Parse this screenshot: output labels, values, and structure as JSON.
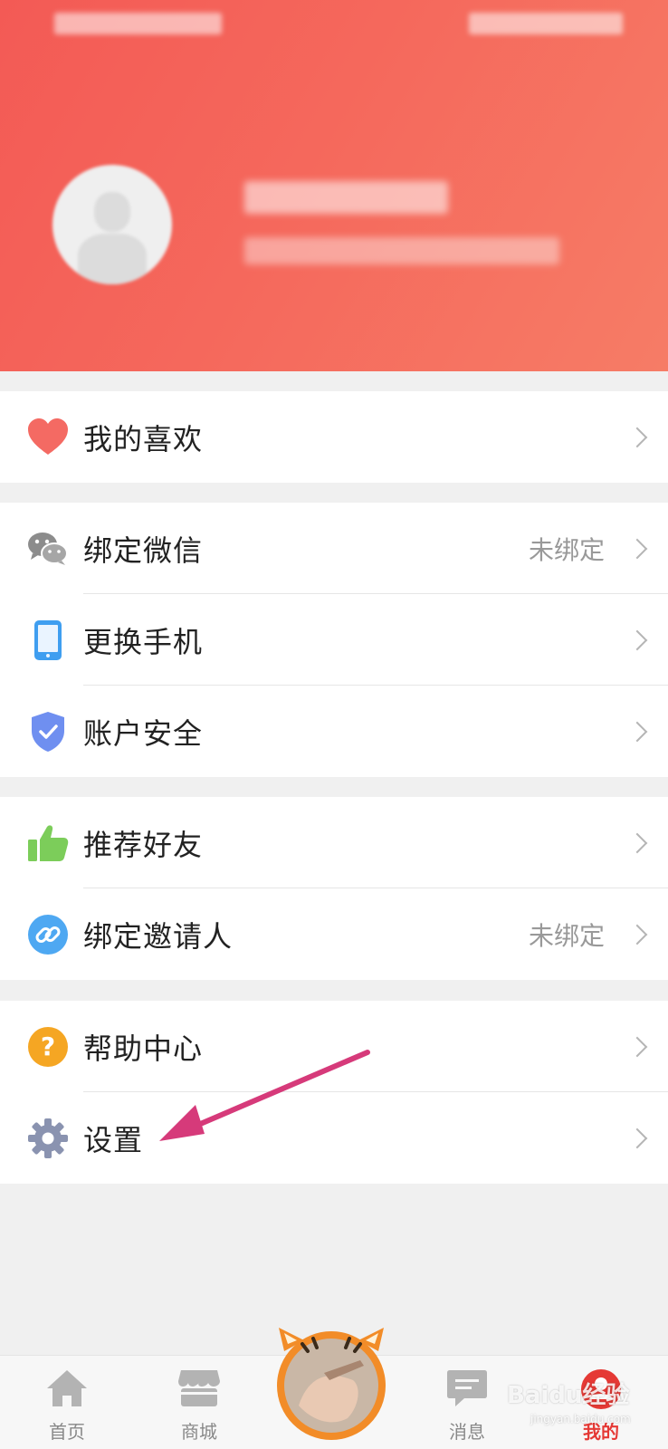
{
  "profile": {
    "status_bar": "",
    "username": "",
    "user_info": ""
  },
  "menu": {
    "favorites": {
      "label": "我的喜欢"
    },
    "bind_wechat": {
      "label": "绑定微信",
      "value": "未绑定"
    },
    "change_phone": {
      "label": "更换手机"
    },
    "account_security": {
      "label": "账户安全"
    },
    "recommend_friends": {
      "label": "推荐好友"
    },
    "bind_inviter": {
      "label": "绑定邀请人",
      "value": "未绑定"
    },
    "help_center": {
      "label": "帮助中心"
    },
    "settings": {
      "label": "设置"
    }
  },
  "bottom_nav": {
    "home": {
      "label": "首页"
    },
    "mall": {
      "label": "商城"
    },
    "messages": {
      "label": "消息"
    },
    "mine": {
      "label": "我的"
    }
  },
  "watermark": {
    "brand": "Baidu经验",
    "url": "jingyan.baidu.com"
  },
  "colors": {
    "header": "#f35a55",
    "active_nav": "#e53935",
    "annotation_arrow": "#d63a7a"
  }
}
